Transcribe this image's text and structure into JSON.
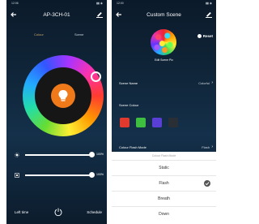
{
  "left_screen": {
    "status_time": "12:06",
    "device_title": "AP-3CH-01",
    "tabs": [
      {
        "label": "Colour"
      },
      {
        "label": "Scene"
      }
    ],
    "active_tab": "Colour",
    "brightness_value": "100%",
    "brightness_level": 1.0,
    "temperature_value": "100%",
    "temperature_level": 1.0,
    "bottom": {
      "left_label": "Left time",
      "right_label": "Schedule"
    },
    "colors": {
      "accent": "#f07a1a",
      "tab_active": "#c8a66a"
    }
  },
  "right_screen": {
    "status_time": "12:00",
    "title": "Custom Scene",
    "edit_pic_label": "Edit Scene Pic",
    "reset_label": "Reset",
    "scene_name_label": "Scene Name",
    "scene_name_value": "Colorful",
    "scene_colour_label": "Scene Colour",
    "swatches": [
      "#e03a2f",
      "#3fbf3f",
      "#5a3fd6",
      "#2a2f36"
    ],
    "flash_mode_label": "Colour Flash Mode",
    "flash_mode_value": "Flash",
    "sheet_title": "Colour Flash Mode",
    "options": [
      {
        "label": "Static"
      },
      {
        "label": "Flash"
      },
      {
        "label": "Breath"
      },
      {
        "label": "Down"
      }
    ],
    "selected_option": "Flash"
  }
}
